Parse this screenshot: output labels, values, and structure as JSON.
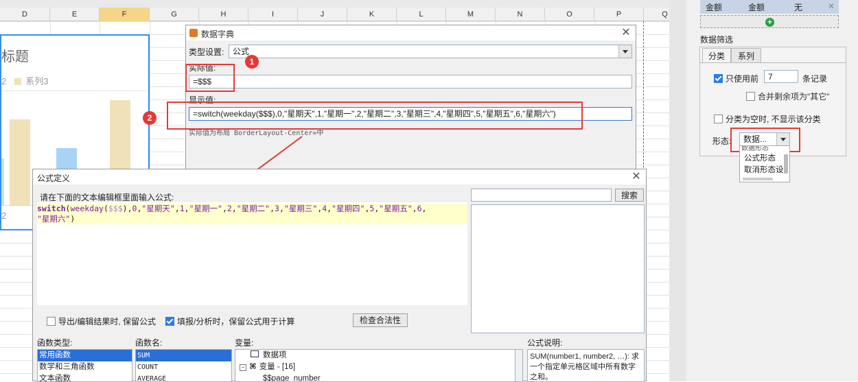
{
  "spreadsheet": {
    "columns": [
      "D",
      "E",
      "F",
      "G",
      "H",
      "I",
      "J",
      "K",
      "L",
      "M",
      "N",
      "O",
      "P",
      "Q"
    ],
    "chart": {
      "title": "标题",
      "legend_prefix": "2",
      "legend_series": "系列3",
      "axis_label": "2"
    }
  },
  "dict_dialog": {
    "title": "数据字典",
    "type_label": "类型设置:",
    "type_value": "公式",
    "actual_label": "实际值:",
    "actual_value": "=$$$",
    "display_label": "显示值:",
    "display_value": "=switch(weekday($$$),0,\"星期天\",1,\"星期一\",2,\"星期二\",3,\"星期三\",4,\"星期四\",5,\"星期五\",6,\"星期六\")",
    "hint": "实际值为布局 BorderLayout-Center=中",
    "badge1": "1",
    "badge2": "2"
  },
  "formula_dialog": {
    "title": "公式定义",
    "instruction": "请在下面的文本编辑框里面输入公式:",
    "search_placeholder": "",
    "search_button": "搜索",
    "option_keep_export": "导出/编辑结果时, 保留公式",
    "option_keep_fill": "填报/分析时，保留公式用于计算",
    "check_button": "检查合法性",
    "func_type_label": "函数类型:",
    "func_types": [
      "常用函数",
      "数学和三角函数",
      "文本函数"
    ],
    "func_name_label": "函数名:",
    "func_names": [
      "SUM",
      "COUNT",
      "AVERAGE"
    ],
    "var_label": "变量:",
    "var_items": [
      "数据项",
      "变量 - [16]",
      "$$page_number"
    ],
    "desc_label": "公式说明:",
    "desc_text": "SUM(number1, number2, …): 求一个指定单元格区域中所有数字之和。"
  },
  "right_panel": {
    "table_headers": [
      "金额",
      "金额",
      "无"
    ],
    "filter_title": "数据筛选",
    "tabs": [
      "分类",
      "系列"
    ],
    "only_use_label": "只使用前",
    "only_use_value": "7",
    "records_label": "条记录",
    "merge_label": "合并剩余项为\"其它\"",
    "empty_hide_label": "分类为空时, 不显示该分类",
    "shape_label": "形态:",
    "shape_value": "数据...",
    "dropdown_items": [
      "数据形态",
      "公式形态",
      "取消形态设"
    ]
  }
}
